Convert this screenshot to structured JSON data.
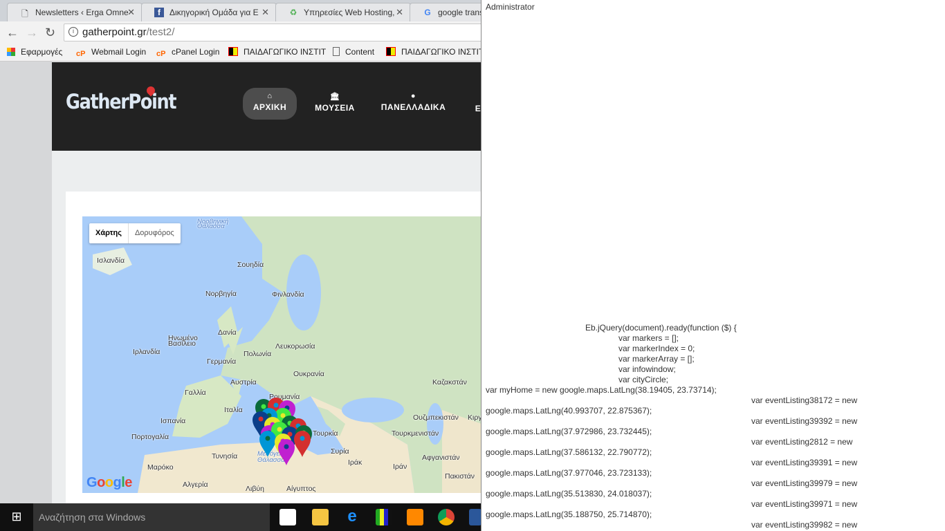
{
  "browser": {
    "tabs": [
      {
        "title": "Newsletters ‹ Erga Omne",
        "icon": "page-icon"
      },
      {
        "title": "Δικηγορική Ομάδα για Ε",
        "icon": "facebook-icon"
      },
      {
        "title": "Υπηρεσίες Web Hosting,",
        "icon": "leaf-icon"
      },
      {
        "title": "google transa",
        "icon": "google-icon"
      }
    ],
    "close_glyph": "✕",
    "url_host": "gatherpoint.gr",
    "url_path": "/test2/",
    "bookmarks": [
      {
        "label": "Εφαρμογές",
        "icon": "apps-icon"
      },
      {
        "label": "Webmail Login",
        "icon": "cpanel-icon"
      },
      {
        "label": "cPanel Login",
        "icon": "cpanel-icon"
      },
      {
        "label": "ΠΑΙΔΑΓΩΓΙΚΟ ΙΝΣΤΙΤ",
        "icon": "pi-icon"
      },
      {
        "label": "Content",
        "icon": "page-icon"
      },
      {
        "label": "ΠΑΙΔΑΓΩΓΙΚΟ ΙΝΣΤΙΤ",
        "icon": "pi-icon"
      }
    ]
  },
  "site": {
    "logo": "GatherPoint",
    "menu": [
      {
        "label": "ΑΡΧΙΚΗ",
        "icon": "home-icon",
        "active": true
      },
      {
        "label": "ΜΟΥΣΕΙΑ",
        "icon": "museum-icon"
      },
      {
        "label": "ΠΑΝΕΛΛΑΔΙΚΑ",
        "icon": "globe-icon"
      },
      {
        "label": "Ε"
      }
    ]
  },
  "map": {
    "types": [
      "Χάρτης",
      "Δορυφόρος"
    ],
    "labels": [
      "Νορβηγική",
      "Θάλασσα",
      "Ισλανδία",
      "Σουηδία",
      "Φινλανδία",
      "Νορβηγία",
      "Δανία",
      "Ηνωμένο",
      "Βασίλειο",
      "Ιρλανδία",
      "Πολωνία",
      "Λευκορωσία",
      "Γερμανία",
      "Ουκρανία",
      "Αυστρία",
      "Γαλλία",
      "Ρουμανία",
      "Ιταλία",
      "Ισπανία",
      "Πορτογαλία",
      "Τουρκία",
      "Καζακστάν",
      "Ουζμπεκιστάν",
      "Κιργι",
      "Τουρκμενιστάν",
      "Συρία",
      "Ιράκ",
      "Ιράν",
      "Αφγανιστάν",
      "Μαρόκο",
      "Αλγερία",
      "Λιβύη",
      "Αίγυπτος",
      "Πακιστάν",
      "Τυνησία",
      "Μεσόγειος",
      "Θάλασσα"
    ],
    "google_logo": "Google",
    "marker_colors": [
      "#0b6b3a",
      "#d32f2f",
      "#c020d0",
      "#42e842",
      "#0096d6",
      "#0b3f8a",
      "#e8e82a"
    ]
  },
  "taskbar": {
    "search_placeholder": "Αναζήτηση στα Windows"
  },
  "panel": {
    "title": "Administrator",
    "code": {
      "ready": "Eb.jQuery(document).ready(function ($) {",
      "vars": [
        "var markers = [];",
        "var markerIndex = 0;",
        "var markerArray = [];",
        "var infowindow;",
        "var cityCircle;"
      ],
      "home": "var myHome = new google.maps.LatLng(38.19405, 23.73714);",
      "listings": [
        {
          "decl": "var eventListing38172 = new",
          "latlng": "google.maps.LatLng(40.993707, 22.875367);"
        },
        {
          "decl": "var eventListing39392 = new",
          "latlng": "google.maps.LatLng(37.972986, 23.732445);"
        },
        {
          "decl": "var eventListing2812 = new",
          "latlng": "google.maps.LatLng(37.586132, 22.790772);"
        },
        {
          "decl": "var eventListing39391 = new",
          "latlng": "google.maps.LatLng(37.977046, 23.723133);"
        },
        {
          "decl": "var eventListing39979 = new",
          "latlng": "google.maps.LatLng(35.513830, 24.018037);"
        },
        {
          "decl": "var eventListing39971 = new",
          "latlng": "google.maps.LatLng(35.188750, 25.714870);"
        },
        {
          "decl": "var eventListing39982 = new"
        }
      ]
    }
  }
}
